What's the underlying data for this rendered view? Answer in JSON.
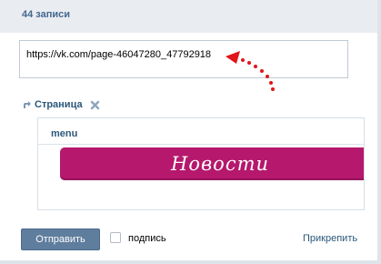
{
  "header": {
    "posts_count": "44 записи"
  },
  "composer": {
    "link_value": "https://vk.com/page-46047280_47792918"
  },
  "attachment": {
    "type_label": "Страница",
    "preview_title": "menu",
    "banner_text": "Новости",
    "banner_color": "#b5186d"
  },
  "footer": {
    "send_label": "Отправить",
    "sign_label": "подпись",
    "sign_checked": false,
    "pin_label": "Прикрепить"
  },
  "colors": {
    "link": "#2b587a",
    "button": "#5f7d9d",
    "annotation_arrow": "#e0161b"
  },
  "icons": {
    "attachment_type": "share-arrow-icon",
    "remove": "close-x-icon",
    "annotation": "dotted-arrow-annotation"
  }
}
